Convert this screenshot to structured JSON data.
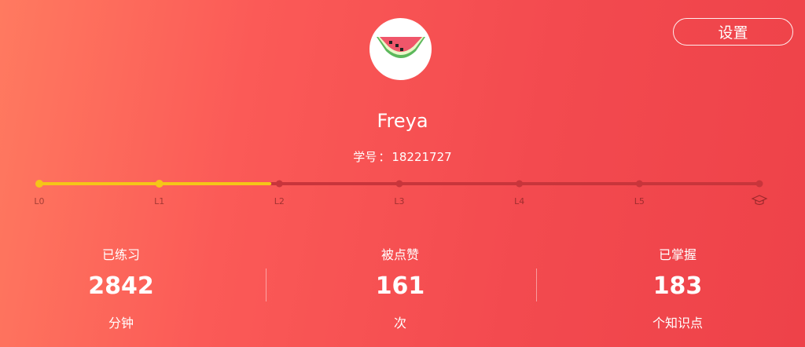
{
  "header": {
    "settings_label": "设置"
  },
  "profile": {
    "avatar_icon": "watermelon-icon",
    "name": "Freya",
    "id_label": "学号",
    "id_separator": "：",
    "id_value": "18221727"
  },
  "levels": {
    "labels": [
      "L0",
      "L1",
      "L2",
      "L3",
      "L4",
      "L5"
    ],
    "end_icon": "graduation-cap-icon",
    "progress_fraction": 0.32,
    "colors": {
      "active": "#f5c518",
      "inactive": "#c8353b"
    }
  },
  "stats": [
    {
      "title": "已练习",
      "value": "2842",
      "unit": "分钟"
    },
    {
      "title": "被点赞",
      "value": "161",
      "unit": "次"
    },
    {
      "title": "已掌握",
      "value": "183",
      "unit": "个知识点"
    }
  ]
}
